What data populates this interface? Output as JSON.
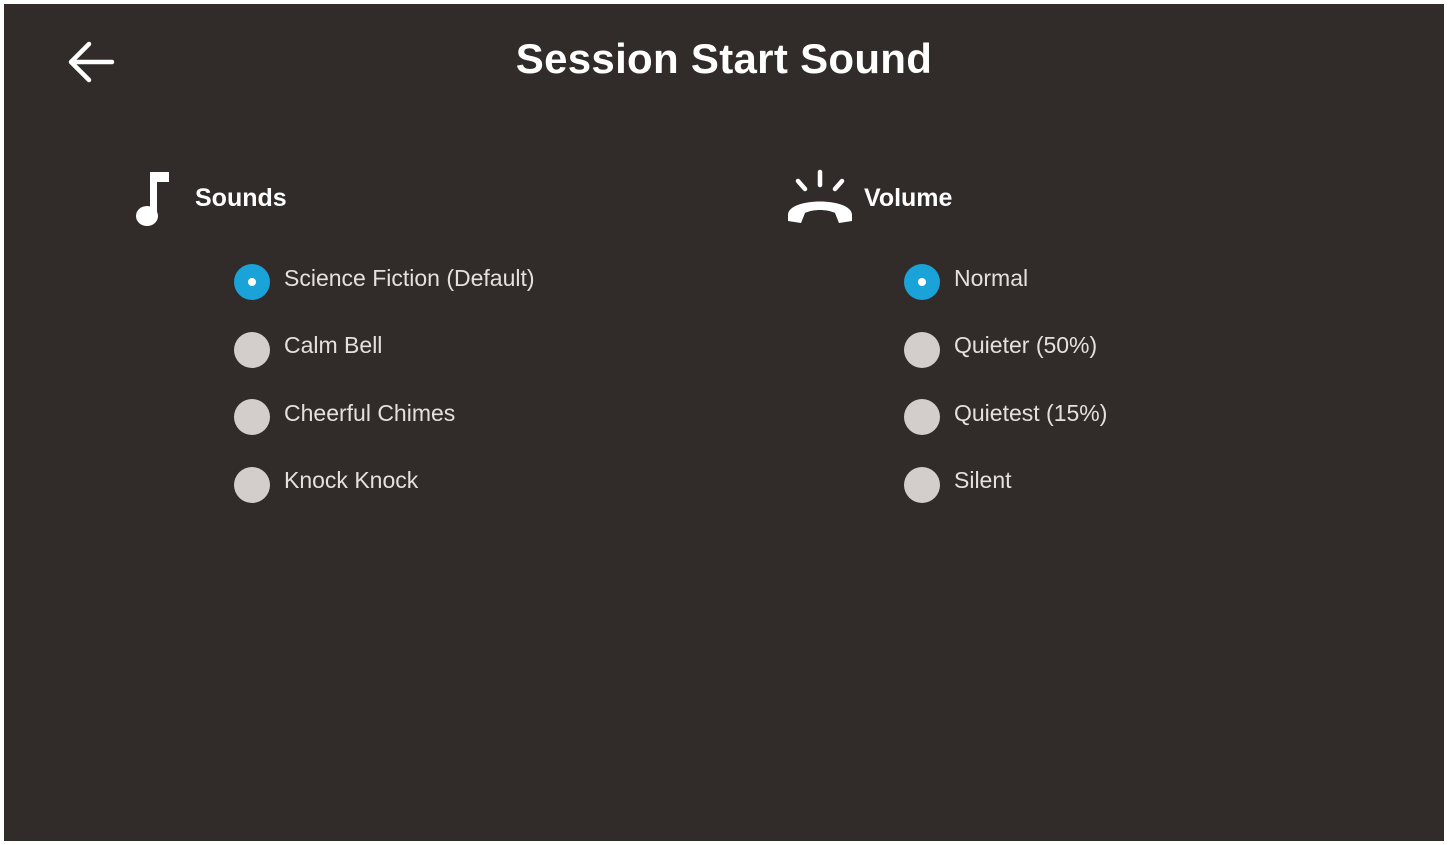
{
  "header": {
    "title": "Session Start Sound",
    "back_icon": "arrow-left-icon"
  },
  "sounds": {
    "title": "Sounds",
    "icon": "music-note-icon",
    "options": [
      {
        "label": "Science Fiction (Default)",
        "selected": true
      },
      {
        "label": "Calm Bell",
        "selected": false
      },
      {
        "label": "Cheerful Chimes",
        "selected": false
      },
      {
        "label": "Knock Knock",
        "selected": false
      }
    ]
  },
  "volume": {
    "title": "Volume",
    "icon": "ringing-phone-icon",
    "options": [
      {
        "label": "Normal",
        "selected": true
      },
      {
        "label": "Quieter (50%)",
        "selected": false
      },
      {
        "label": "Quietest (15%)",
        "selected": false
      },
      {
        "label": "Silent",
        "selected": false
      }
    ]
  },
  "colors": {
    "background": "#312c2a",
    "accent": "#1aa3d9",
    "radio_unselected": "#d3cecb",
    "text": "#ffffff"
  }
}
